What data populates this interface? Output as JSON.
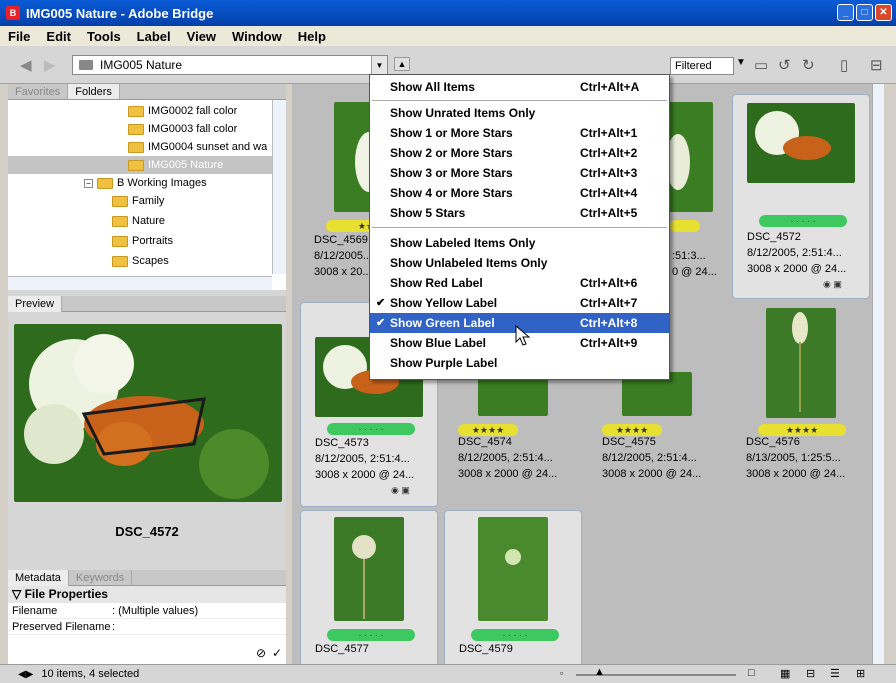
{
  "window": {
    "title": "IMG005 Nature - Adobe Bridge"
  },
  "menubar": [
    "File",
    "Edit",
    "Tools",
    "Label",
    "View",
    "Window",
    "Help"
  ],
  "toolbar": {
    "path": "IMG005 Nature",
    "filter": "Filtered"
  },
  "left": {
    "tabs": [
      "Favorites",
      "Folders"
    ],
    "folders": [
      {
        "label": "IMG0002 fall color"
      },
      {
        "label": "IMG0003 fall color"
      },
      {
        "label": "IMG0004 sunset and wa"
      },
      {
        "label": "IMG005 Nature"
      },
      {
        "label": "B Working Images"
      },
      {
        "label": "Family"
      },
      {
        "label": "Nature"
      },
      {
        "label": "Portraits"
      },
      {
        "label": "Scapes"
      }
    ],
    "preview_tab": "Preview",
    "preview_name": "DSC_4572",
    "meta_tabs": [
      "Metadata",
      "Keywords"
    ],
    "meta_header": "File Properties",
    "meta_rows": [
      {
        "k": "Filename",
        "v": ": (Multiple values)"
      },
      {
        "k": "Preserved Filename",
        "v": ":"
      }
    ]
  },
  "thumbs": [
    {
      "name": "DSC_4569",
      "date": "8/12/2005...",
      "dims": "3008 x 20...",
      "label": "yellow",
      "rating": "★★★"
    },
    {
      "name": "",
      "date": "",
      "dims": "",
      "label": "none",
      "rating": ""
    },
    {
      "name": "",
      "date": ":51:3...",
      "dims": "0 @ 24...",
      "label": "yellow",
      "rating": ""
    },
    {
      "name": "DSC_4572",
      "date": "8/12/2005, 2:51:4...",
      "dims": "3008 x 2000 @ 24...",
      "label": "green",
      "rating": "· · · · ·"
    },
    {
      "name": "DSC_4573",
      "date": "8/12/2005, 2:51:4...",
      "dims": "3008 x 2000 @ 24...",
      "label": "green",
      "rating": "· · · · ·"
    },
    {
      "name": "DSC_4574",
      "date": "8/12/2005, 2:51:4...",
      "dims": "3008 x 2000 @ 24...",
      "label": "yellow",
      "rating": "★★★★"
    },
    {
      "name": "DSC_4575",
      "date": "8/12/2005, 2:51:4...",
      "dims": "3008 x 2000 @ 24...",
      "label": "yellow",
      "rating": "★★★★"
    },
    {
      "name": "DSC_4576",
      "date": "8/13/2005, 1:25:5...",
      "dims": "3008 x 2000 @ 24...",
      "label": "yellow",
      "rating": "★★★★"
    },
    {
      "name": "DSC_4577",
      "date": "",
      "dims": "",
      "label": "green",
      "rating": "· · · · ·"
    },
    {
      "name": "DSC_4579",
      "date": "",
      "dims": "",
      "label": "green",
      "rating": "· · · · ·"
    }
  ],
  "menu": [
    {
      "label": "Show All Items",
      "shortcut": "Ctrl+Alt+A",
      "checked": false
    },
    {
      "label": "Show Unrated Items Only",
      "shortcut": "",
      "checked": false
    },
    {
      "label": "Show 1 or More Stars",
      "shortcut": "Ctrl+Alt+1",
      "checked": false
    },
    {
      "label": "Show 2 or More Stars",
      "shortcut": "Ctrl+Alt+2",
      "checked": false
    },
    {
      "label": "Show 3 or More Stars",
      "shortcut": "Ctrl+Alt+3",
      "checked": false
    },
    {
      "label": "Show 4 or More Stars",
      "shortcut": "Ctrl+Alt+4",
      "checked": false
    },
    {
      "label": "Show 5 Stars",
      "shortcut": "Ctrl+Alt+5",
      "checked": false
    },
    {
      "label": "Show Labeled Items Only",
      "shortcut": "",
      "checked": false
    },
    {
      "label": "Show Unlabeled Items Only",
      "shortcut": "",
      "checked": false
    },
    {
      "label": "Show Red Label",
      "shortcut": "Ctrl+Alt+6",
      "checked": false
    },
    {
      "label": "Show Yellow Label",
      "shortcut": "Ctrl+Alt+7",
      "checked": true
    },
    {
      "label": "Show Green Label",
      "shortcut": "Ctrl+Alt+8",
      "checked": true
    },
    {
      "label": "Show Blue Label",
      "shortcut": "Ctrl+Alt+9",
      "checked": false
    },
    {
      "label": "Show Purple Label",
      "shortcut": "",
      "checked": false
    }
  ],
  "status": {
    "text": "10 items, 4 selected"
  },
  "colors": {
    "yellow_label": "#e8e030",
    "green_label": "#3ec860",
    "highlight": "#3163c6"
  }
}
